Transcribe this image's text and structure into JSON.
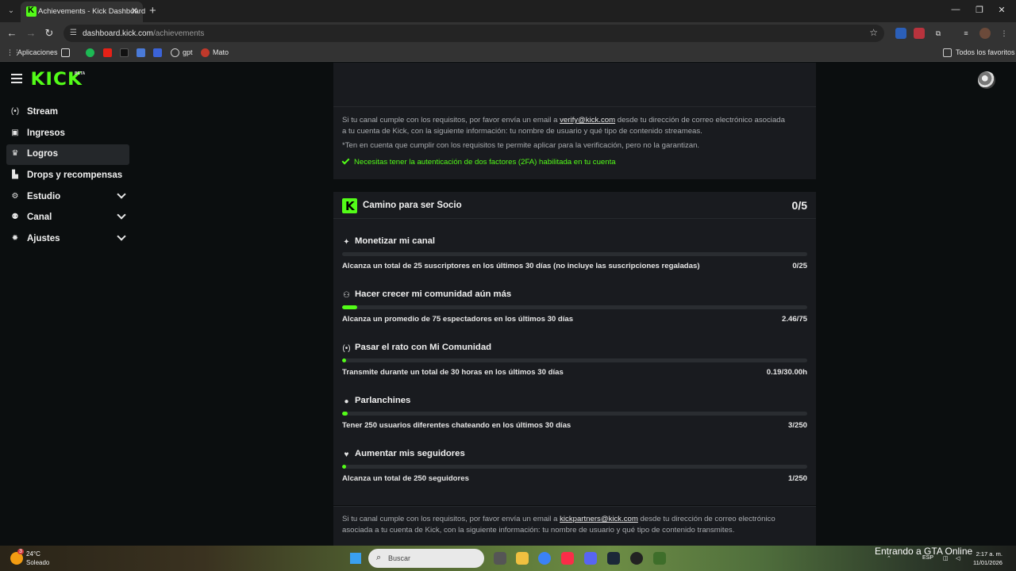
{
  "browser": {
    "tab_title": "Achievements - Kick Dashboard",
    "url_host": "dashboard.kick.com",
    "url_path": "/achievements",
    "bookmarks": [
      {
        "label": "Aplicaciones"
      },
      {
        "label": "gpt"
      },
      {
        "label": "Mato"
      }
    ],
    "all_favorites": "Todos los favoritos"
  },
  "app": {
    "logo": "KICK",
    "logo_badge": "BETA"
  },
  "sidebar": {
    "items": [
      {
        "label": "Stream",
        "icon": "broadcast-icon"
      },
      {
        "label": "Ingresos",
        "icon": "wallet-icon"
      },
      {
        "label": "Logros",
        "icon": "trophy-icon",
        "active": true
      },
      {
        "label": "Drops y recompensas",
        "icon": "chart-icon"
      },
      {
        "label": "Estudio",
        "icon": "gear-icon",
        "expandable": true
      },
      {
        "label": "Canal",
        "icon": "users-icon",
        "expandable": true
      },
      {
        "label": "Ajustes",
        "icon": "settings-icon",
        "expandable": true
      }
    ]
  },
  "verification": {
    "text_before_link": "Si tu canal cumple con los requisitos, por favor envía un email a ",
    "link": "verify@kick.com",
    "text_after_link": " desde tu dirección de correo electrónico asociada",
    "text_line2": "a tu cuenta de Kick, con la siguiente información: tu nombre de usuario y qué tipo de contenido streameas.",
    "note": "*Ten en cuenta que cumplir con los requisitos te permite aplicar para la verificación, pero no la garantizan.",
    "requirement": "Necesitas tener la autenticación de dos factores (2FA) habilitada en tu cuenta"
  },
  "partner": {
    "title": "Camino para ser Socio",
    "count": "0/5",
    "goals": [
      {
        "icon": "sparkle-icon",
        "title": "Monetizar mi canal",
        "desc": "Alcanza un total de 25 suscriptores en los últimos 30 días (no incluye las suscripciones regaladas)",
        "value": "0/25",
        "progress": 0.0
      },
      {
        "icon": "community-icon",
        "title": "Hacer crecer mi comunidad aún más",
        "desc": "Alcanza un promedio de 75 espectadores en los últimos 30 días",
        "value": "2.46/75",
        "progress": 0.033
      },
      {
        "icon": "broadcast-icon",
        "title": "Pasar el rato con Mi Comunidad",
        "desc": "Transmite durante un total de 30 horas en los últimos 30 días",
        "value": "0.19/30.00h",
        "progress": 0.0063
      },
      {
        "icon": "chat-icon",
        "title": "Parlanchines",
        "desc": "Tener 250 usuarios diferentes chateando en los últimos 30 días",
        "value": "3/250",
        "progress": 0.012
      },
      {
        "icon": "heart-icon",
        "title": "Aumentar mis seguidores",
        "desc": "Alcanza un total de 250 seguidores",
        "value": "1/250",
        "progress": 0.004
      }
    ],
    "footer_before_link": "Si tu canal cumple con los requisitos, por favor envía un email a ",
    "footer_link": "kickpartners@kick.com",
    "footer_after_link": " desde tu dirección de correo electrónico",
    "footer_line2": "asociada a tu cuenta de Kick, con la siguiente información: tu nombre de usuario y qué tipo de contenido transmites."
  },
  "taskbar": {
    "weather_temp": "24°C",
    "weather_desc": "Soleado",
    "weather_badge": "3",
    "search_placeholder": "Buscar",
    "notification": "Entrando a GTA Online",
    "lang": "ESP",
    "time": "2:17 a. m.",
    "date": "11/01/2026"
  }
}
